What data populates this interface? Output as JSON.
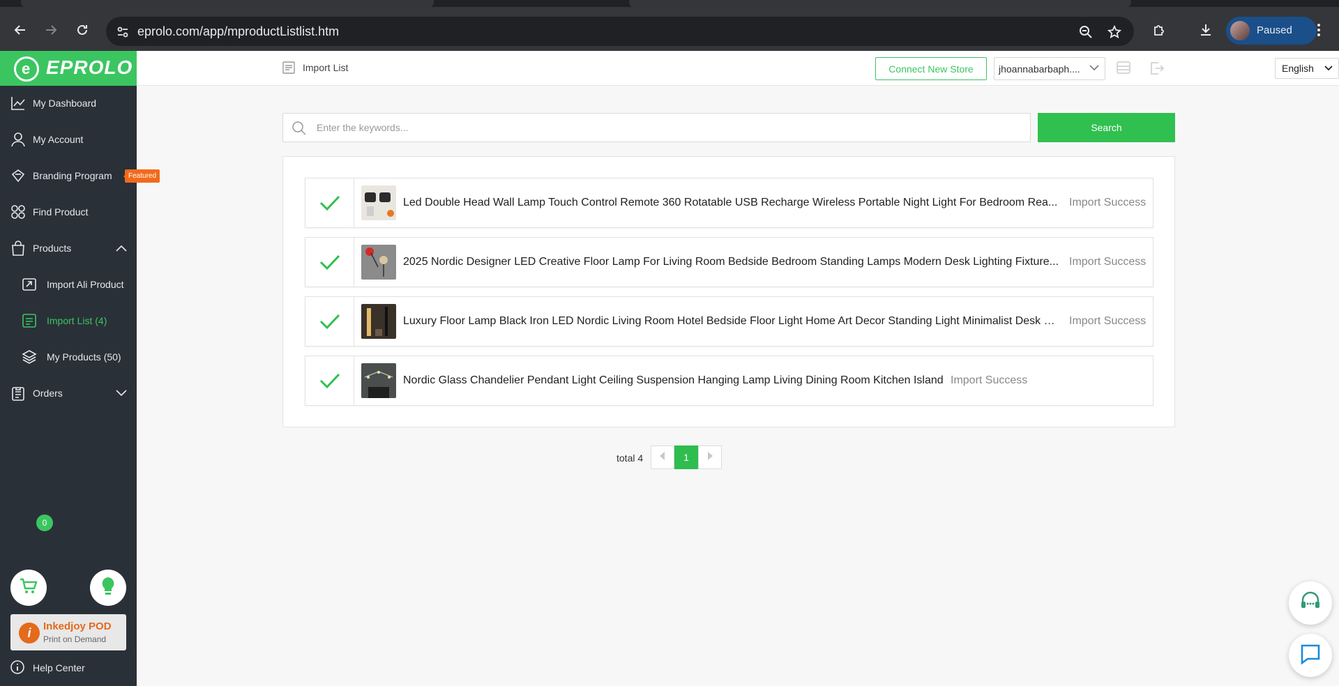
{
  "browser": {
    "url": "eprolo.com/app/mproductListlist.htm",
    "profile_label": "Paused"
  },
  "brand": {
    "logo_text": "EPROLO",
    "accent": "#3bc561",
    "sidebar_bg": "#2a3038"
  },
  "sidebar": {
    "items": [
      {
        "label": "My Dashboard",
        "icon": "chart-line-icon"
      },
      {
        "label": "My Account",
        "icon": "user-icon"
      },
      {
        "label": "Branding Program",
        "icon": "diamond-icon",
        "badge": "Featured"
      },
      {
        "label": "Find Product",
        "icon": "grid-icon"
      },
      {
        "label": "Products",
        "icon": "shopping-bag-icon"
      },
      {
        "label": "Import Ali Product",
        "icon": "import-icon"
      },
      {
        "label": "Import List (4)",
        "icon": "list-icon"
      },
      {
        "label": "My Products (50)",
        "icon": "layers-icon"
      },
      {
        "label": "Orders",
        "icon": "clipboard-icon"
      }
    ],
    "cart_count": "0",
    "promo_title": "Inkedjoy POD",
    "promo_subtitle": "Print on Demand",
    "help_label": "Help Center"
  },
  "header": {
    "breadcrumb": "Import List",
    "connect_label": "Connect New Store",
    "store_value": "jhoannabarbaph....",
    "language": "English"
  },
  "search": {
    "placeholder": "Enter the keywords...",
    "button_label": "Search"
  },
  "import_list": [
    {
      "title": "Led Double Head Wall Lamp Touch Control Remote 360 Rotatable USB Recharge Wireless Portable Night Light For Bedroom Rea...",
      "status": "Import Success"
    },
    {
      "title": "2025 Nordic Designer LED Creative Floor Lamp For Living Room Bedside Bedroom Standing Lamps Modern Desk Lighting Fixture...",
      "status": "Import Success"
    },
    {
      "title": "Luxury Floor Lamp Black Iron LED Nordic Living Room Hotel Bedside Floor Light Home Art Decor Standing Light Minimalist Desk L...",
      "status": "Import Success"
    },
    {
      "title": "Nordic Glass Chandelier Pendant Light Ceiling Suspension Hanging Lamp Living Dining Room Kitchen Island",
      "status": "Import Success"
    }
  ],
  "pagination": {
    "total_label": "total 4",
    "current_page": "1"
  }
}
